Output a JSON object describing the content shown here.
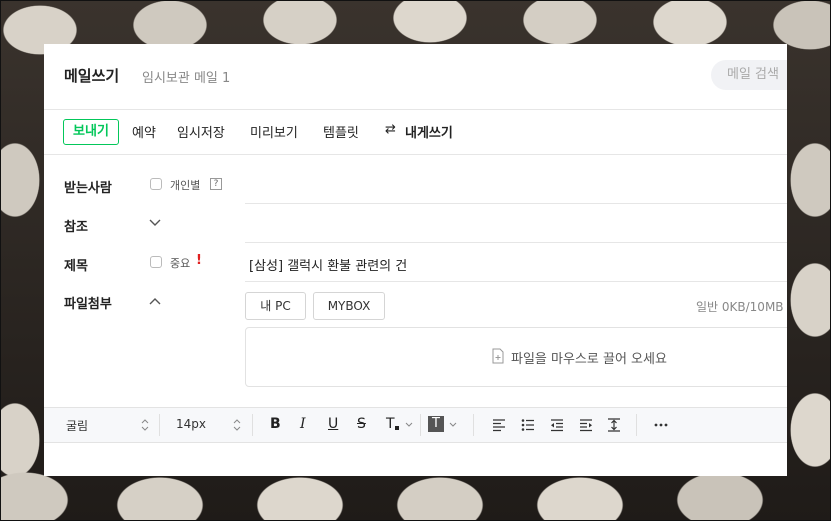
{
  "header": {
    "title": "메일쓰기",
    "draft": "임시보관 메일 1",
    "search_placeholder": "메일 검색"
  },
  "toolbar": {
    "send": "보내기",
    "schedule": "예약",
    "save_draft": "임시저장",
    "preview": "미리보기",
    "template": "템플릿",
    "self_write": "내게쓰기"
  },
  "form": {
    "to_label": "받는사람",
    "individual_label": "개인별",
    "help_mark": "?",
    "cc_label": "참조",
    "subject_label": "제목",
    "important_label": "중요",
    "important_mark": "!",
    "subject_value": "[삼성] 갤럭시 환불 관련의 건",
    "attach_label": "파일첨부",
    "my_pc": "내 PC",
    "mybox": "MYBOX",
    "file_size": "일반 0KB/10MB",
    "drop_hint": "파일을 마우스로 끌어 오세요"
  },
  "editor": {
    "font": "굴림",
    "size": "14px",
    "icons": [
      "bold-icon",
      "italic-icon",
      "underline-icon",
      "strikethrough-icon",
      "text-color-icon",
      "background-color-icon",
      "align-icon",
      "list-icon",
      "outdent-icon",
      "indent-icon",
      "line-height-icon",
      "more-icon"
    ]
  },
  "colors": {
    "accent": "#03c75a",
    "important": "#e02020"
  }
}
